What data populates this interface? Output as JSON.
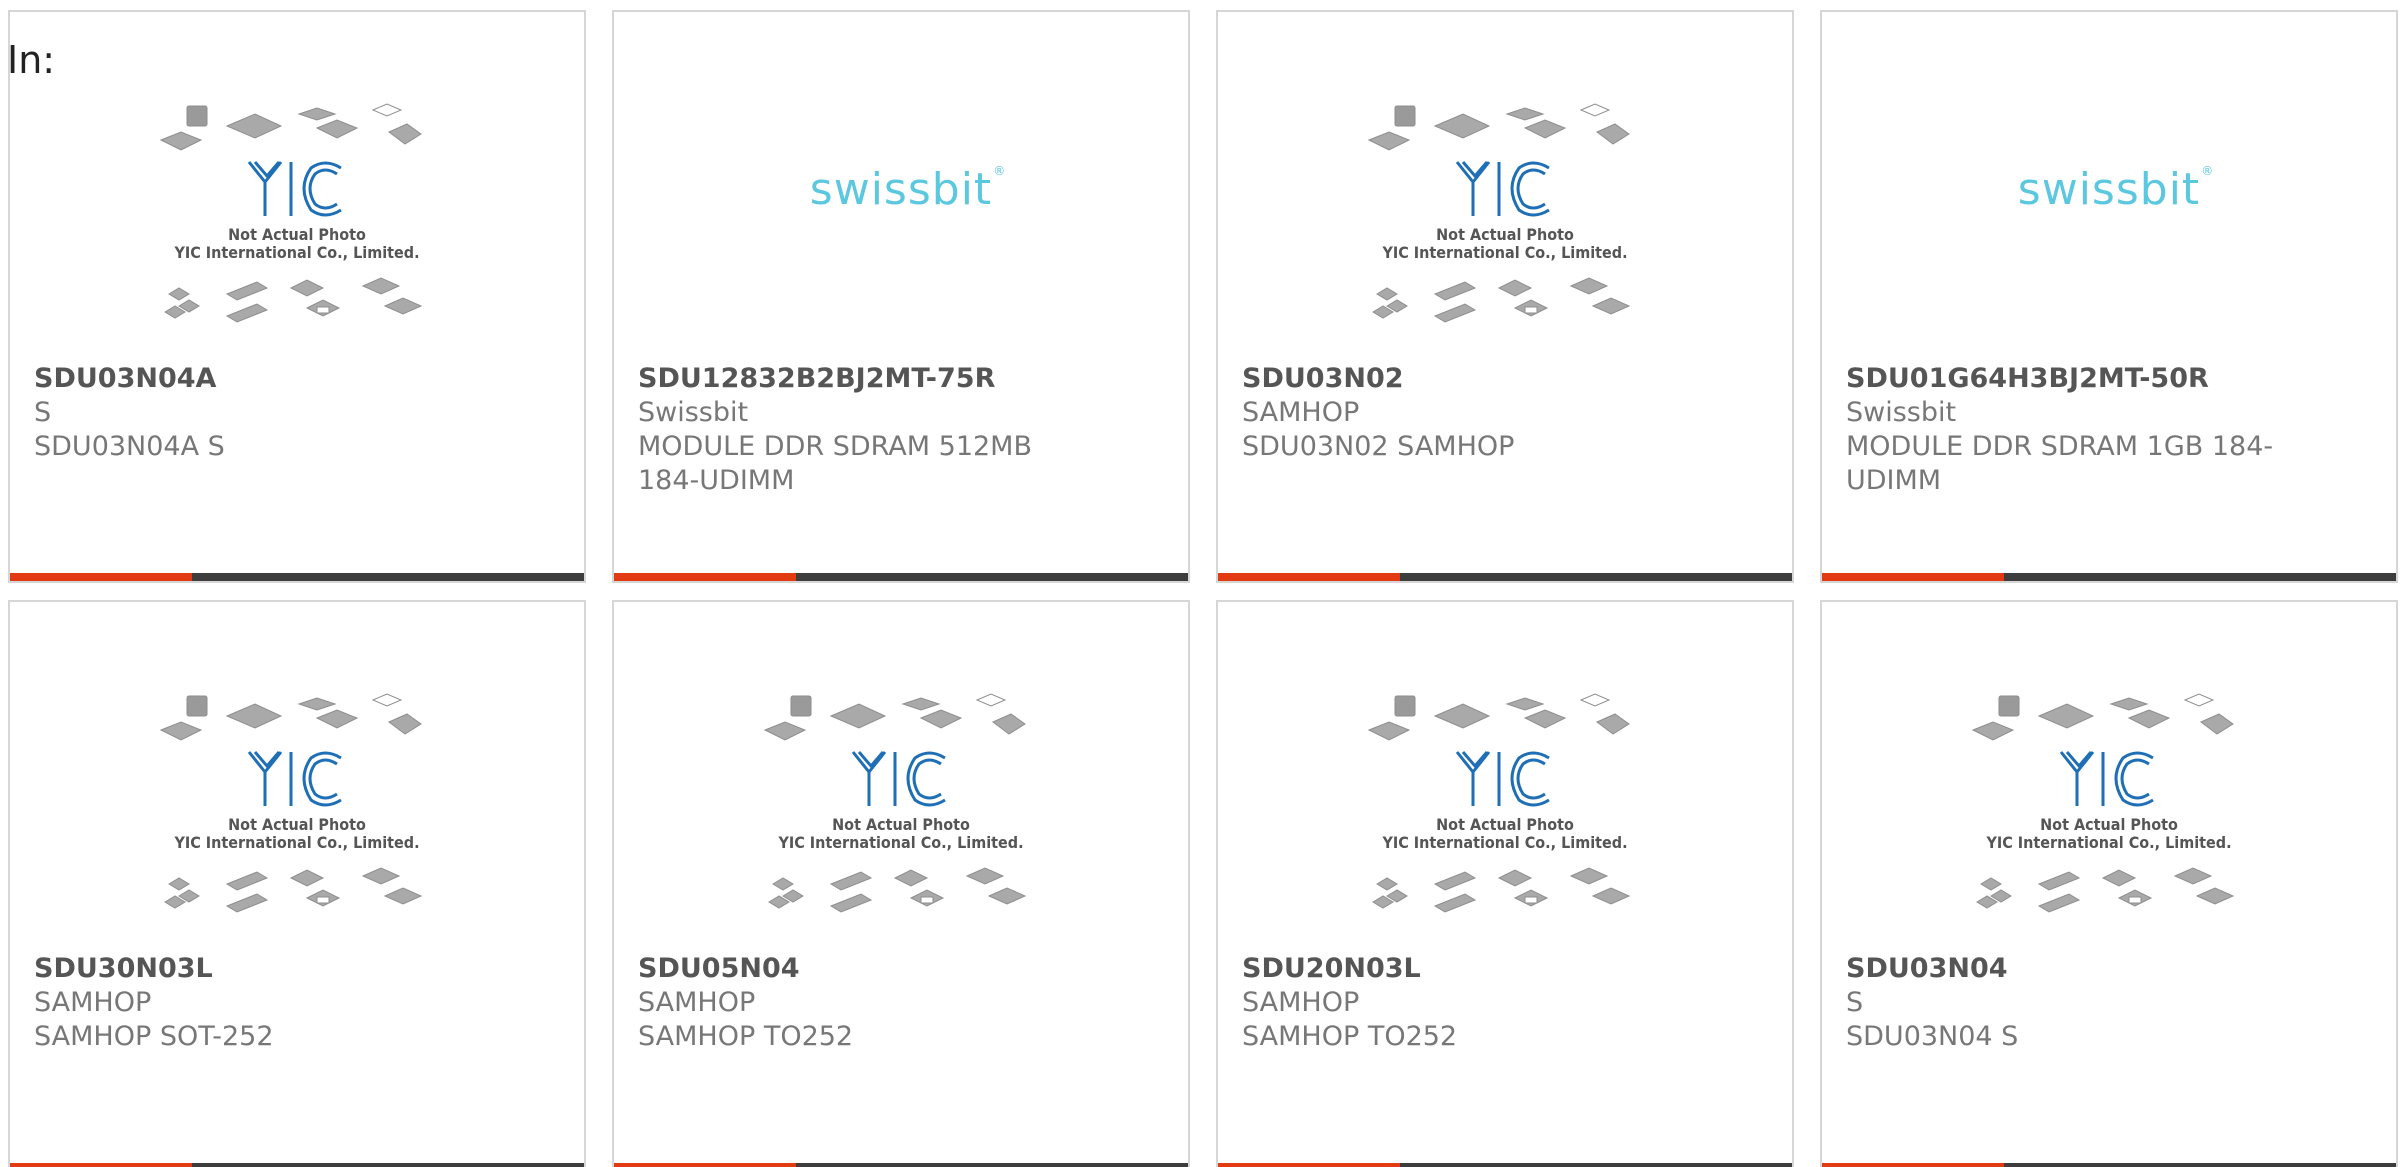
{
  "header": {
    "label": "In:"
  },
  "placeholder_image": {
    "logo": "YIC",
    "line1": "Not Actual Photo",
    "line2": "YIC International Co., Limited."
  },
  "colors": {
    "accent": "#e23b12",
    "bar": "#3d3d3d",
    "swissbit": "#5bc8e0",
    "yic_blue": "#1e6fb5"
  },
  "products": [
    {
      "part": "SDU03N04A",
      "manufacturer": "S",
      "description": "SDU03N04A S",
      "image": "yic-placeholder"
    },
    {
      "part": "SDU12832B2BJ2MT-75R",
      "manufacturer": "Swissbit",
      "description": "MODULE DDR SDRAM 512MB 184-UDIMM",
      "image": "swissbit-logo",
      "logo_text": "swissbit"
    },
    {
      "part": "SDU03N02",
      "manufacturer": "SAMHOP",
      "description": "SDU03N02 SAMHOP",
      "image": "yic-placeholder"
    },
    {
      "part": "SDU01G64H3BJ2MT-50R",
      "manufacturer": "Swissbit",
      "description": "MODULE DDR SDRAM 1GB 184-UDIMM",
      "image": "swissbit-logo",
      "logo_text": "swissbit"
    },
    {
      "part": "SDU30N03L",
      "manufacturer": "SAMHOP",
      "description": "SAMHOP SOT-252",
      "image": "yic-placeholder"
    },
    {
      "part": "SDU05N04",
      "manufacturer": "SAMHOP",
      "description": "SAMHOP TO252",
      "image": "yic-placeholder"
    },
    {
      "part": "SDU20N03L",
      "manufacturer": "SAMHOP",
      "description": "SAMHOP TO252",
      "image": "yic-placeholder"
    },
    {
      "part": "SDU03N04",
      "manufacturer": "S",
      "description": "SDU03N04 S",
      "image": "yic-placeholder"
    }
  ]
}
